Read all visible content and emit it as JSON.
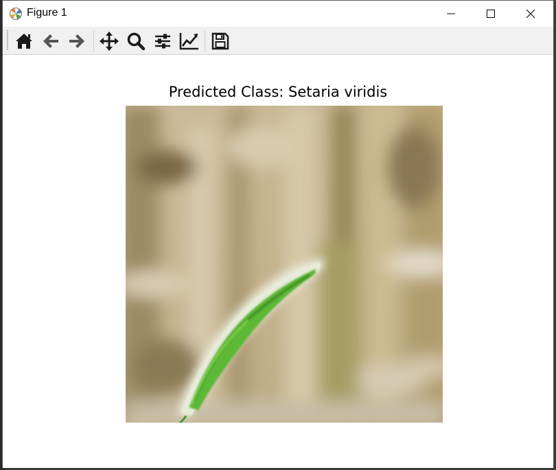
{
  "window": {
    "title": "Figure 1"
  },
  "toolbar": {
    "buttons": [
      {
        "name": "home",
        "icon": "home-icon"
      },
      {
        "name": "back",
        "icon": "arrow-left-icon"
      },
      {
        "name": "forward",
        "icon": "arrow-right-icon"
      },
      {
        "name": "pan",
        "icon": "move-icon"
      },
      {
        "name": "zoom",
        "icon": "magnifier-icon"
      },
      {
        "name": "configure-subplots",
        "icon": "sliders-icon"
      },
      {
        "name": "edit-axes",
        "icon": "line-chart-icon"
      },
      {
        "name": "save",
        "icon": "floppy-disk-icon"
      }
    ]
  },
  "figure": {
    "title": "Predicted Class: Setaria viridis",
    "image_subject": "green foxtail grass spike on blurred wheat field background"
  },
  "colors": {
    "toolbar_bg": "#f0f0f0",
    "icon": "#1a1a1a",
    "plant_green": "#4fae2a"
  }
}
